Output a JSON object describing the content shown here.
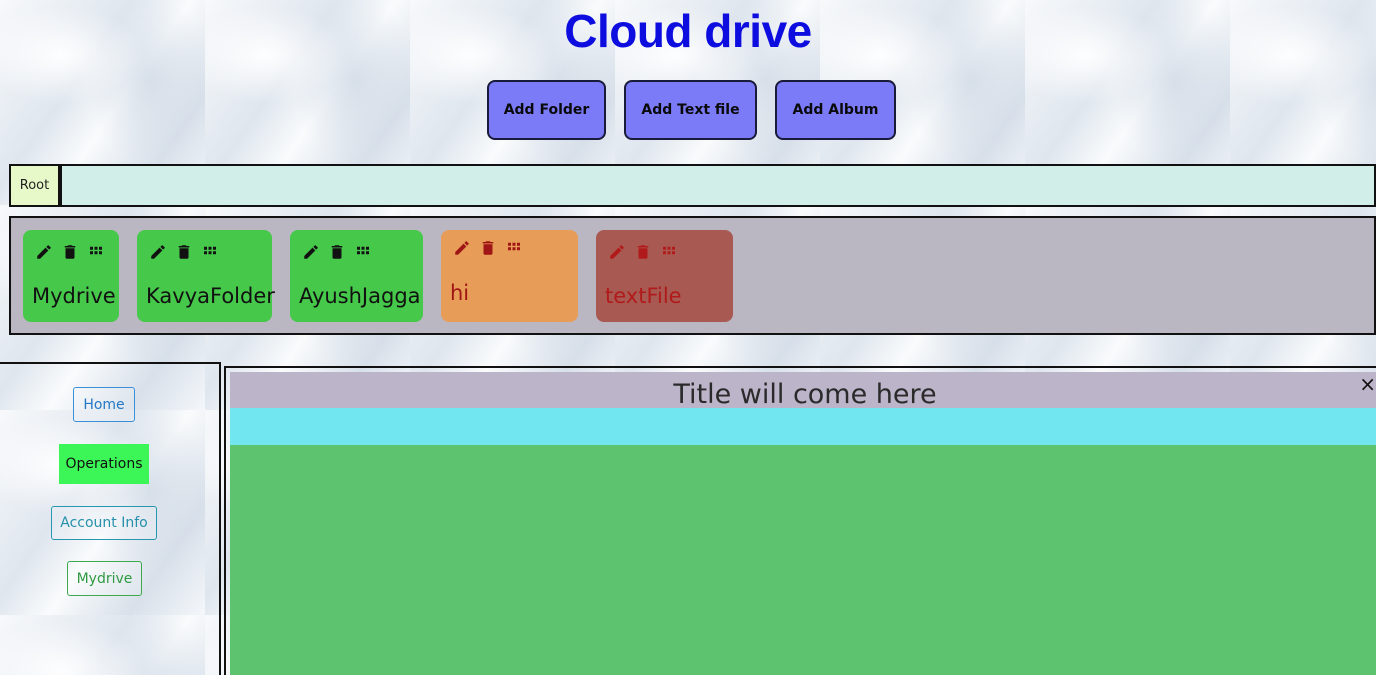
{
  "app": {
    "title": "Cloud drive"
  },
  "toolbar": {
    "add_folder": "Add Folder",
    "add_text_file": "Add Text file",
    "add_album": "Add Album"
  },
  "breadcrumb": {
    "root": "Root"
  },
  "items": [
    {
      "name": "Mydrive",
      "type": "folder"
    },
    {
      "name": "KavyaFolder",
      "type": "folder"
    },
    {
      "name": "AyushJagga",
      "type": "folder"
    },
    {
      "name": "hi",
      "type": "album"
    },
    {
      "name": "textFile",
      "type": "text"
    }
  ],
  "item_icons": [
    "pencil-icon",
    "trash-icon",
    "grid-icon"
  ],
  "sidebar": {
    "home": "Home",
    "operations": "Operations",
    "account_info": "Account Info",
    "mydrive": "Mydrive"
  },
  "viewer": {
    "title": "Title will come here",
    "close": "×"
  },
  "colors": {
    "title": "#0d0de0",
    "button": "#7b7bf7",
    "folder": "#46c84a",
    "album": "#e79d58",
    "text_file": "#a85a52",
    "breadcrumb_bg": "#d1eee8",
    "items_panel_bg": "#bab7c2",
    "operations_active": "#3cf556",
    "viewer_title_bg": "#bcb4c9",
    "viewer_cyan": "#72e6f0",
    "viewer_body": "#5ec36f"
  }
}
